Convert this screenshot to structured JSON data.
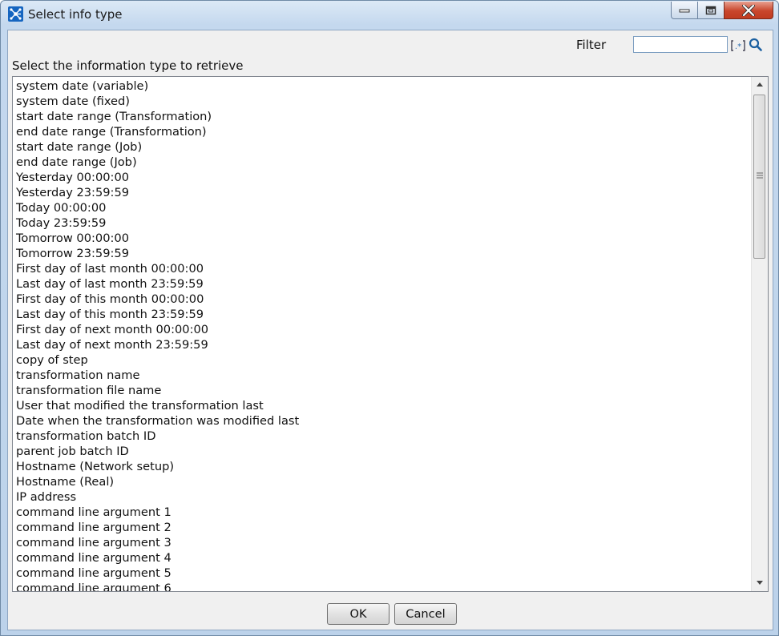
{
  "window": {
    "title": "Select info type"
  },
  "filter": {
    "label": "Filter",
    "value": "",
    "placeholder": ""
  },
  "prompt": "Select the information type to retrieve",
  "items": [
    "system date (variable)",
    "system date (fixed)",
    "start date range (Transformation)",
    "end date range (Transformation)",
    "start date range (Job)",
    "end date range (Job)",
    "Yesterday 00:00:00",
    "Yesterday 23:59:59",
    "Today 00:00:00",
    "Today 23:59:59",
    "Tomorrow 00:00:00",
    "Tomorrow 23:59:59",
    "First day of last month 00:00:00",
    "Last day of last month 23:59:59",
    "First day of this month 00:00:00",
    "Last day of this month 23:59:59",
    "First day of next month 00:00:00",
    "Last day of next month 23:59:59",
    "copy of step",
    "transformation name",
    "transformation file name",
    "User that modified the transformation last",
    "Date when the transformation was modified last",
    "transformation batch ID",
    "parent job batch ID",
    "Hostname (Network setup)",
    "Hostname (Real)",
    "IP address",
    "command line argument 1",
    "command line argument 2",
    "command line argument 3",
    "command line argument 4",
    "command line argument 5",
    "command line argument 6"
  ],
  "buttons": {
    "ok": "OK",
    "cancel": "Cancel"
  },
  "icons": {
    "app": "network-node-icon",
    "regex": "regex-icon",
    "search": "search-icon"
  },
  "colors": {
    "accent": "#1565c0",
    "close_button": "#c9462c"
  }
}
